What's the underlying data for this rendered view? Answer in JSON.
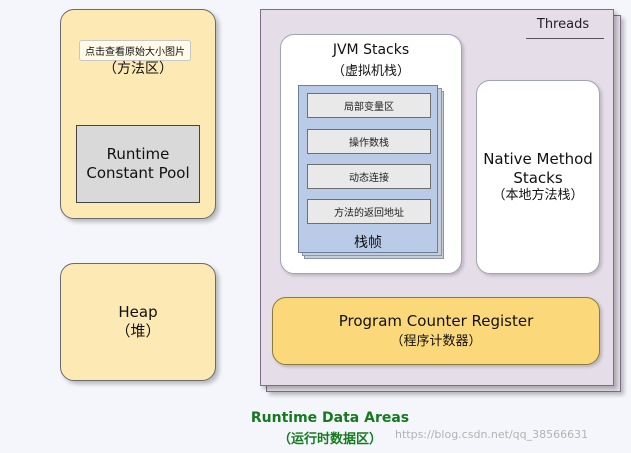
{
  "method_area": {
    "tooltip": "点击查看原始大小图片",
    "label": "（方法区）"
  },
  "constant_pool": {
    "line1": "Runtime",
    "line2": "Constant Pool"
  },
  "heap": {
    "line1": "Heap",
    "line2": "（堆）"
  },
  "threads": {
    "label": "Threads"
  },
  "jvm_stacks": {
    "line1": "JVM Stacks",
    "line2": "（虚拟机栈）"
  },
  "stack_frame": {
    "slots": [
      "局部变量区",
      "操作数栈",
      "动态连接",
      "方法的返回地址"
    ],
    "label": "栈帧"
  },
  "native_stacks": {
    "line1": "Native Method",
    "line2": "Stacks",
    "line3": "（本地方法栈）"
  },
  "pc_register": {
    "line1": "Program Counter Register",
    "line2": "（程序计数器）"
  },
  "runtime_data_areas": {
    "line1": "Runtime Data Areas",
    "line2": "（运行时数据区）"
  },
  "watermark": {
    "text": "https://blog.csdn.net/qq_38566631"
  }
}
